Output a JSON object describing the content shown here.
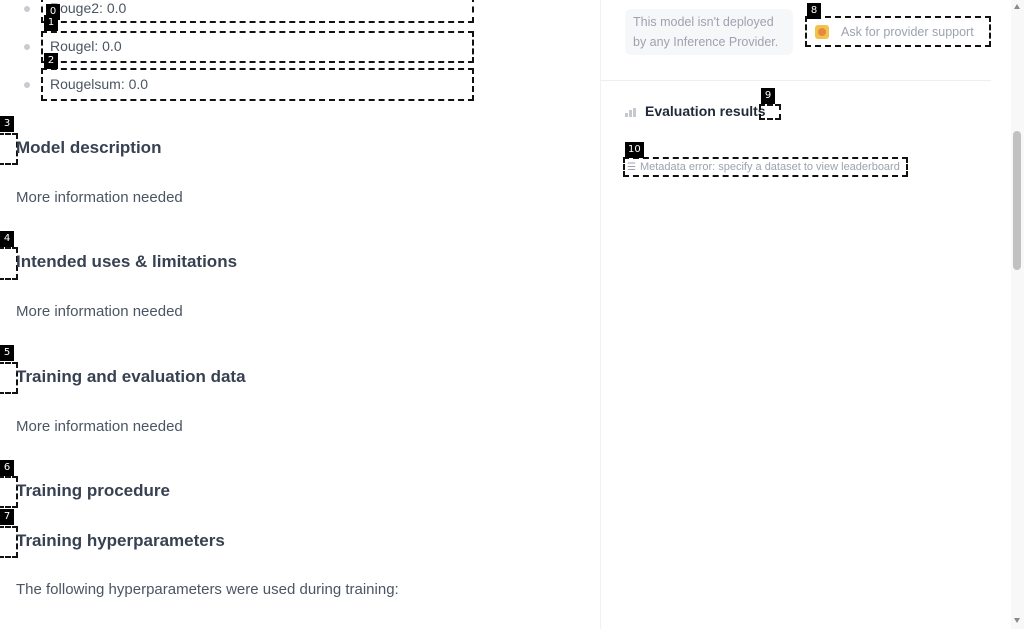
{
  "metrics": [
    {
      "tag": "0",
      "label": "Rouge2: 0.0"
    },
    {
      "tag": "1",
      "label": "Rougel: 0.0"
    },
    {
      "tag": "2",
      "label": "Rougelsum: 0.0"
    }
  ],
  "sections": [
    {
      "tag": "3",
      "heading": "Model description",
      "body": "More information needed"
    },
    {
      "tag": "4",
      "heading": "Intended uses & limitations",
      "body": "More information needed"
    },
    {
      "tag": "5",
      "heading": "Training and evaluation data",
      "body": "More information needed"
    },
    {
      "tag": "6",
      "heading": "Training procedure"
    },
    {
      "tag": "7",
      "heading": "Training hyperparameters",
      "body": "The following hyperparameters were used during training:"
    }
  ],
  "sidebar": {
    "not_deployed_text": "This model isn't deployed by any Inference Provider.",
    "provider_support": {
      "tag": "8",
      "label": "Ask for provider support"
    },
    "eval_title": "Evaluation results",
    "eval_info_tag": "9",
    "metadata_error": {
      "tag": "10",
      "label": "Metadata error: specify a dataset to view leaderboard"
    }
  },
  "icons": {
    "provider": "raising-hand-emoji-icon",
    "eval": "bar-chart-icon",
    "info": "info-icon",
    "list": "list-icon"
  }
}
